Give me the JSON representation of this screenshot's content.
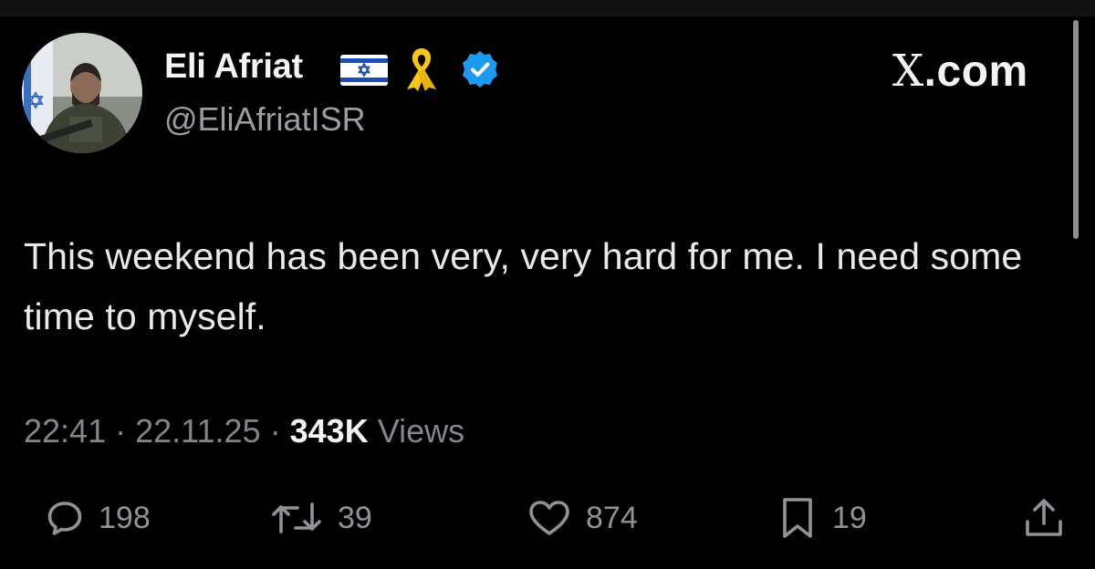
{
  "author": {
    "name": "Eli Afriat",
    "handle": "@EliAfriatISR"
  },
  "brand": {
    "x_glyph": "X",
    "domain": ".com"
  },
  "tweet": {
    "text": "This weekend has been very, very hard for me. I need some time to myself.",
    "time": "22:41",
    "separator": "·",
    "date": "22.11.25",
    "views_count": "343K",
    "views_label": "Views"
  },
  "actions": {
    "replies": "198",
    "reposts": "39",
    "likes": "874",
    "bookmarks": "19"
  },
  "icons": [
    "flag-israel-icon",
    "yellow-ribbon-icon",
    "verified-badge-icon",
    "reply-icon",
    "repost-icon",
    "like-icon",
    "bookmark-icon",
    "share-icon"
  ],
  "colors": {
    "background": "#000000",
    "verified": "#1d9bf0",
    "ribbon": "#f5c518",
    "secondary_text": "#80868b"
  }
}
